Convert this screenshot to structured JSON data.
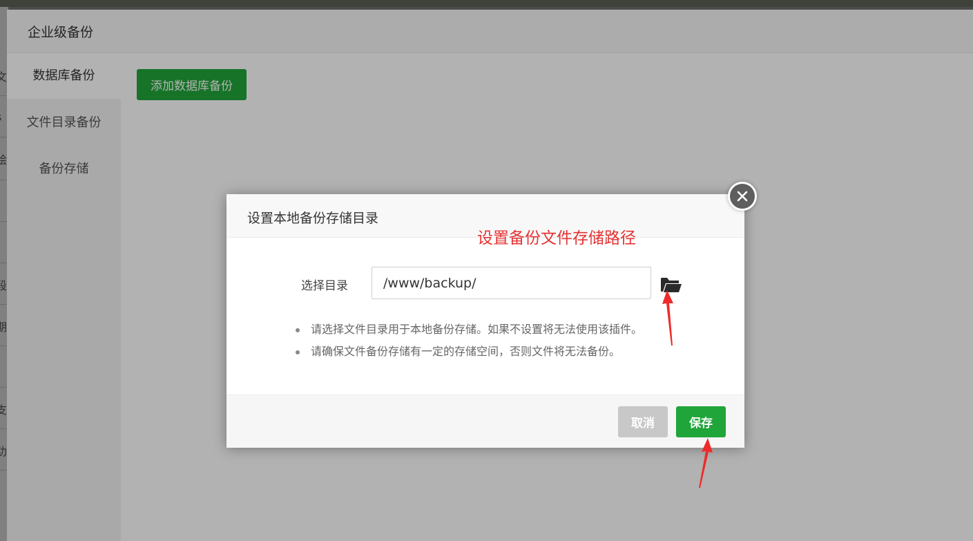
{
  "background_page": {
    "title": "企业级备份",
    "sidebar": {
      "items": [
        {
          "label": "数据库备份",
          "active": true
        },
        {
          "label": "文件目录备份",
          "active": false
        },
        {
          "label": "备份存储",
          "active": false
        }
      ]
    },
    "add_button_label": "添加数据库备份",
    "left_fragments": [
      "文",
      "s",
      "绘",
      "段",
      "期",
      "支",
      "功"
    ]
  },
  "modal": {
    "title": "设置本地备份存储目录",
    "field_label": "选择目录",
    "path_value": "/www/backup/",
    "tips": [
      "请选择文件目录用于本地备份存储。如果不设置将无法使用该插件。",
      "请确保文件备份存储有一定的存储空间，否则文件将无法备份。"
    ],
    "cancel_label": "取消",
    "save_label": "保存"
  },
  "annotation": {
    "text": "设置备份文件存储路径",
    "color": "#e53333"
  },
  "colors": {
    "accent": "#20a53a",
    "cancel": "#c8c8c8"
  },
  "icons": {
    "close": "close-icon",
    "folder": "folder-open-icon"
  }
}
